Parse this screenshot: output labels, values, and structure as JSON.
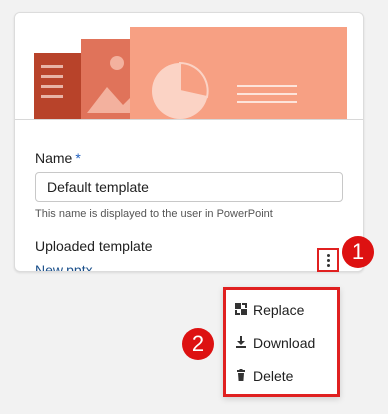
{
  "form": {
    "name_label": "Name",
    "required_marker": "*",
    "name_value": "Default template",
    "name_helper": "This name is displayed to the user in PowerPoint",
    "uploaded_label": "Uploaded template",
    "file_name": "New.pptx"
  },
  "menu": {
    "items": [
      {
        "label": "Replace",
        "icon": "replace-icon"
      },
      {
        "label": "Download",
        "icon": "download-icon"
      },
      {
        "label": "Delete",
        "icon": "trash-icon"
      }
    ]
  },
  "callouts": {
    "step1": "1",
    "step2": "2"
  },
  "colors": {
    "callout_red": "#dd1111",
    "link_blue": "#1a4f8a",
    "thumbnail_dark": "#b8432a",
    "thumbnail_mid": "#e0735a",
    "thumbnail_light": "#f7a083"
  }
}
